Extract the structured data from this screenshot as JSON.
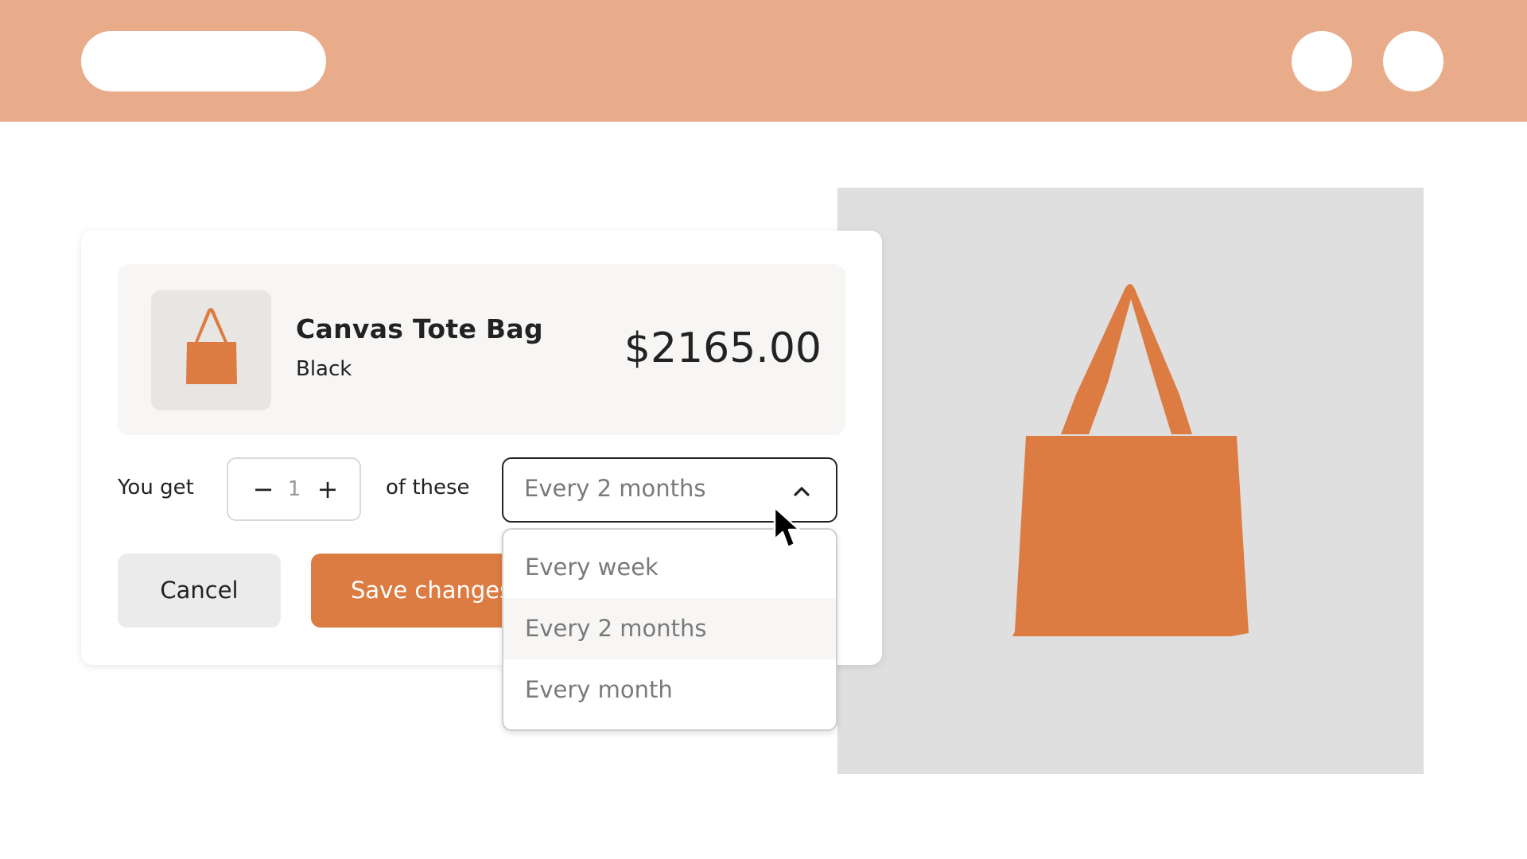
{
  "browser": {
    "address_bar": "",
    "window_buttons": [
      "window-button",
      "window-button"
    ]
  },
  "product": {
    "name": "Canvas Tote Bag",
    "variant": "Black",
    "price": "$2165.00",
    "thumbnail_icon": "tote-bag-icon",
    "image_icon": "tote-bag-icon"
  },
  "subscription": {
    "you_get_label": "You get",
    "quantity": {
      "value": "1",
      "decrement_label": "−",
      "increment_label": "+"
    },
    "of_these_label": "of these",
    "frequency": {
      "selected": "Every 2 months",
      "expanded": true,
      "options": [
        "Every week",
        "Every 2 months",
        "Every month"
      ],
      "highlighted_option": "Every 2 months"
    }
  },
  "actions": {
    "cancel_label": "Cancel",
    "save_label": "Save changes"
  },
  "colors": {
    "accent": "#dc7c42",
    "topbar": "#e8ac8a",
    "image_panel": "#dfdfdf"
  }
}
